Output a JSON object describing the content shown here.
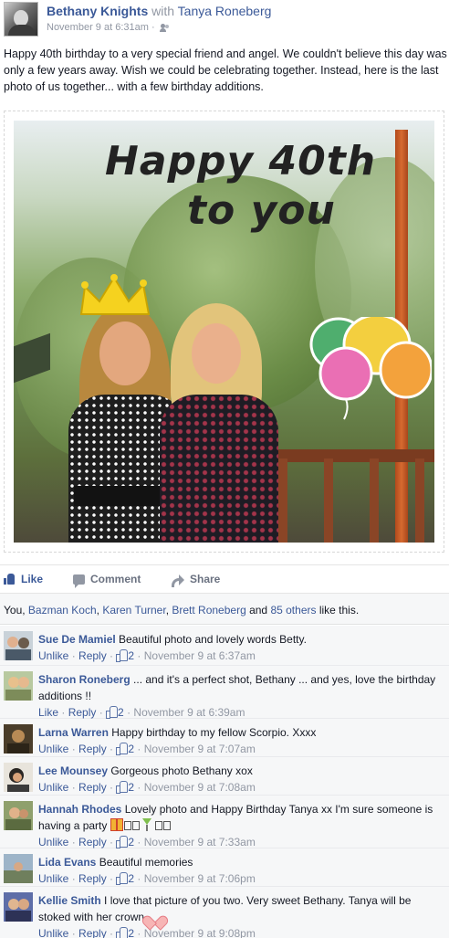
{
  "post": {
    "author": "Bethany Knights",
    "with_text": "with",
    "tagged": "Tanya Roneberg",
    "timestamp": "November 9 at 6:31am",
    "audience_sep": "·",
    "body": "Happy 40th birthday to a very special friend and angel. We couldn't believe this day was only a few years away. Wish we could be celebrating together. Instead, here is the last photo of us together... with a few birthday additions.",
    "photo": {
      "greeting_line1": "Happy 40th",
      "greeting_line2": "to you"
    }
  },
  "actions": {
    "like": "Like",
    "comment": "Comment",
    "share": "Share"
  },
  "likes_summary": {
    "prefix": "You, ",
    "names": [
      "Bazman Koch",
      "Karen Turner",
      "Brett Roneberg"
    ],
    "sep1": ", ",
    "sep2": ", ",
    "and": " and ",
    "others": "85 others",
    "suffix": " like this."
  },
  "comments": [
    {
      "name": "Sue De Mamiel",
      "text": "Beautiful photo and lovely words Betty.",
      "action": "Unlike",
      "reply": "Reply",
      "likes": "2",
      "time": "November 9 at 6:37am"
    },
    {
      "name": "Sharon Roneberg",
      "text": "... and it's a perfect shot, Bethany ... and yes, love the birthday additions !!",
      "action": "Like",
      "reply": "Reply",
      "likes": "2",
      "time": "November 9 at 6:39am"
    },
    {
      "name": "Larna Warren",
      "text": "Happy birthday to my fellow Scorpio. Xxxx",
      "action": "Unlike",
      "reply": "Reply",
      "likes": "2",
      "time": "November 9 at 7:07am"
    },
    {
      "name": "Lee Mounsey",
      "text": "Gorgeous photo Bethany xox",
      "action": "Unlike",
      "reply": "Reply",
      "likes": "2",
      "time": "November 9 at 7:08am"
    },
    {
      "name": "Hannah Rhodes",
      "text": "Lovely photo and Happy Birthday Tanya xx I'm sure someone is having a party",
      "action": "Unlike",
      "reply": "Reply",
      "likes": "2",
      "time": "November 9 at 7:33am"
    },
    {
      "name": "Lida Evans",
      "text": "Beautiful memories",
      "action": "Unlike",
      "reply": "Reply",
      "likes": "2",
      "time": "November 9 at 7:06pm"
    },
    {
      "name": "Kellie Smith",
      "text": "I love that picture of you two. Very sweet Bethany. Tanya will be stoked with her crown",
      "action": "Unlike",
      "reply": "Reply",
      "likes": "2",
      "time": "November 9 at 9:08pm"
    }
  ],
  "colors": {
    "link": "#3b5998",
    "meta": "#9197a3",
    "comment_bg": "#f6f7f8"
  }
}
